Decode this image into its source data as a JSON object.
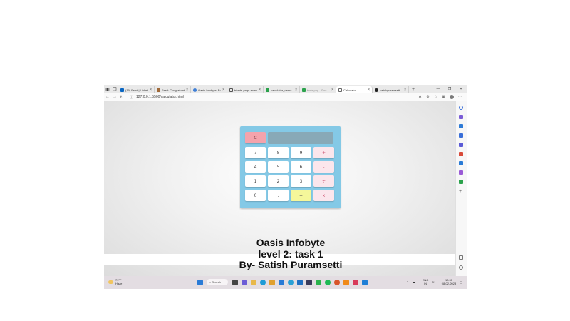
{
  "tabs": [
    {
      "label": "(19) Feed | LinkedIn",
      "icon_color": "#0a66c2"
    },
    {
      "label": "Feed: Congratulati…",
      "icon_color": "#a06a3a"
    },
    {
      "label": "Oasis Infobyte: Ed…",
      "icon_color": "#3f7fd6"
    },
    {
      "label": "tribute-page-exam…",
      "icon_color": "#555555"
    },
    {
      "label": "calculator_demo -…",
      "icon_color": "#2ba24c"
    },
    {
      "label": "tests.png - Goo…",
      "icon_color": "#2ba24c"
    },
    {
      "label": "Calculator",
      "icon_color": "#666666",
      "active": true
    },
    {
      "label": "satishpuramsetti…",
      "icon_color": "#222222"
    }
  ],
  "url": "127.0.0.1:5500/calculator.html",
  "calculator": {
    "clear": "C",
    "row1": [
      "7",
      "8",
      "9",
      "+"
    ],
    "row2": [
      "4",
      "5",
      "6",
      "-"
    ],
    "row3": [
      "1",
      "2",
      "3",
      "÷"
    ],
    "row4": [
      "0",
      ".",
      "=",
      "x"
    ]
  },
  "caption": {
    "line1": "Oasis Infobyte",
    "line2": "level 2: task 1",
    "line3": "By- Satish Puramsetti"
  },
  "taskbar": {
    "weather_temp": "79°F",
    "weather_desc": "Haze",
    "search": "Search",
    "lang": "ENG",
    "region": "IN",
    "time": "10:31",
    "date": "08-02-2023"
  },
  "colors": {
    "calculator_body": "#84c9e6",
    "display": "#88a9b7",
    "clear_button": "#f4a3ac",
    "operator_button": "#fbe6ec",
    "equals_button": "#f5f79a"
  }
}
